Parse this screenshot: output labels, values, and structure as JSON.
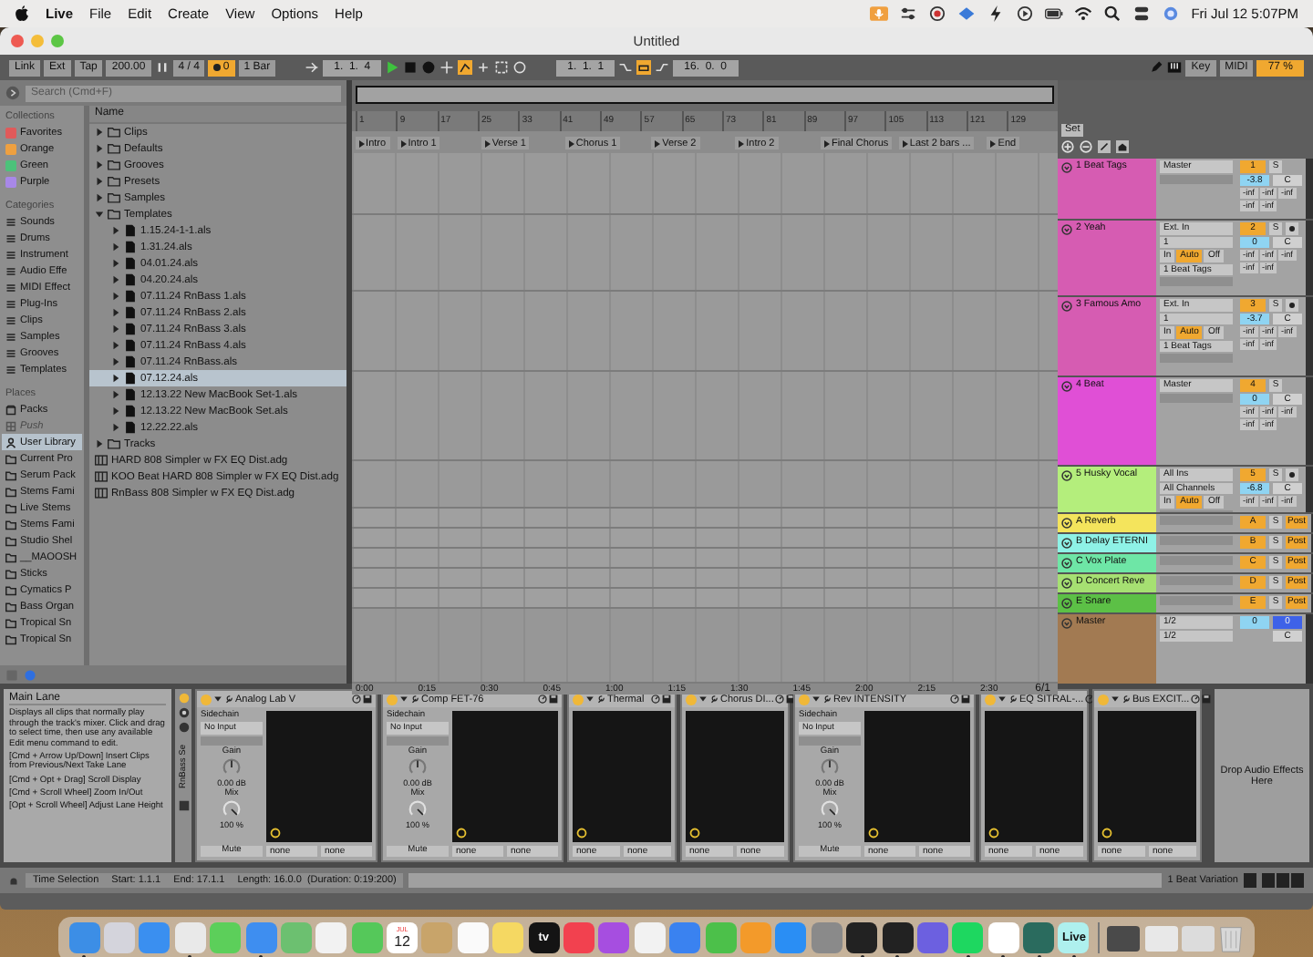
{
  "menu_bar": {
    "app": "Live",
    "items": [
      "File",
      "Edit",
      "Create",
      "View",
      "Options",
      "Help"
    ],
    "clock": "Fri Jul 12  5:07PM"
  },
  "window": {
    "title": "Untitled"
  },
  "transport": {
    "buttons": [
      "Link",
      "Ext",
      "Tap"
    ],
    "tempo": "200.00",
    "signature": "4 / 4",
    "metronome": "0",
    "quantize": "1 Bar",
    "position": "1.  1.  4",
    "playing": true,
    "loop_start": "1.  1.  1",
    "loop_length": "16.  0.  0",
    "key": "Key",
    "midi": "MIDI",
    "cpu": "77 %"
  },
  "browser": {
    "search": {
      "placeholder": "Search (Cmd+F)"
    },
    "sections": [
      {
        "title": "Collections",
        "items": [
          {
            "label": "Favorites",
            "kind": "color",
            "color": "#e05a5a",
            "selected": false
          },
          {
            "label": "Orange",
            "kind": "color",
            "color": "#eea040",
            "selected": false
          },
          {
            "label": "Green",
            "kind": "color",
            "color": "#4cc27a",
            "selected": false
          },
          {
            "label": "Purple",
            "kind": "color",
            "color": "#a888e8",
            "selected": false
          }
        ]
      },
      {
        "title": "Categories",
        "items": [
          {
            "label": "Sounds",
            "kind": "category",
            "selected": false
          },
          {
            "label": "Drums",
            "kind": "category",
            "selected": false
          },
          {
            "label": "Instrument",
            "kind": "category",
            "selected": false
          },
          {
            "label": "Audio Effe",
            "kind": "category",
            "selected": false
          },
          {
            "label": "MIDI Effect",
            "kind": "category",
            "selected": false
          },
          {
            "label": "Plug-Ins",
            "kind": "category",
            "selected": false
          },
          {
            "label": "Clips",
            "kind": "category",
            "selected": false
          },
          {
            "label": "Samples",
            "kind": "category",
            "selected": false
          },
          {
            "label": "Grooves",
            "kind": "category",
            "selected": false
          },
          {
            "label": "Templates",
            "kind": "category",
            "selected": false
          }
        ]
      },
      {
        "title": "Places",
        "items": [
          {
            "label": "Packs",
            "kind": "pack",
            "selected": false,
            "disabled": false
          },
          {
            "label": "Push",
            "kind": "device",
            "selected": false,
            "disabled": true
          },
          {
            "label": "User Library",
            "kind": "user",
            "selected": true,
            "disabled": false
          },
          {
            "label": "Current Pro",
            "kind": "folder",
            "selected": false,
            "disabled": false
          },
          {
            "label": "Serum Pack",
            "kind": "folder",
            "selected": false,
            "disabled": false
          },
          {
            "label": "Stems Fami",
            "kind": "folder",
            "selected": false,
            "disabled": false
          },
          {
            "label": "Live Stems",
            "kind": "folder",
            "selected": false,
            "disabled": false
          },
          {
            "label": "Stems Fami",
            "kind": "folder",
            "selected": false,
            "disabled": false
          },
          {
            "label": "Studio Shel",
            "kind": "folder",
            "selected": false,
            "disabled": false
          },
          {
            "label": "__MAOOSH",
            "kind": "folder",
            "selected": false,
            "disabled": false
          },
          {
            "label": "Sticks",
            "kind": "folder",
            "selected": false,
            "disabled": false
          },
          {
            "label": "Cymatics P",
            "kind": "folder",
            "selected": false,
            "disabled": false
          },
          {
            "label": "Bass Organ",
            "kind": "folder",
            "selected": false,
            "disabled": false
          },
          {
            "label": "Tropical Sn",
            "kind": "folder",
            "selected": false,
            "disabled": false
          },
          {
            "label": "Tropical Sn",
            "kind": "folder",
            "selected": false,
            "disabled": false
          }
        ]
      }
    ],
    "column": "Name",
    "items": [
      {
        "label": "Clips",
        "kind": "folder",
        "expanded": false,
        "selected": false
      },
      {
        "label": "Defaults",
        "kind": "folder",
        "expanded": false,
        "selected": false
      },
      {
        "label": "Grooves",
        "kind": "folder",
        "expanded": false,
        "selected": false
      },
      {
        "label": "Presets",
        "kind": "folder",
        "expanded": false,
        "selected": false
      },
      {
        "label": "Samples",
        "kind": "folder",
        "expanded": false,
        "selected": false
      },
      {
        "label": "Templates",
        "kind": "folder",
        "expanded": true,
        "selected": false,
        "children": [
          {
            "label": "1.15.24-1-1.als",
            "kind": "set",
            "selected": false
          },
          {
            "label": "1.31.24.als",
            "kind": "set",
            "selected": false
          },
          {
            "label": "04.01.24.als",
            "kind": "set",
            "selected": false
          },
          {
            "label": "04.20.24.als",
            "kind": "set",
            "selected": false
          },
          {
            "label": "07.11.24 RnBass 1.als",
            "kind": "set",
            "selected": false
          },
          {
            "label": "07.11.24 RnBass 2.als",
            "kind": "set",
            "selected": false
          },
          {
            "label": "07.11.24 RnBass 3.als",
            "kind": "set",
            "selected": false
          },
          {
            "label": "07.11.24 RnBass 4.als",
            "kind": "set",
            "selected": false
          },
          {
            "label": "07.11.24 RnBass.als",
            "kind": "set",
            "selected": false
          },
          {
            "label": "07.12.24.als",
            "kind": "set",
            "selected": true
          },
          {
            "label": "12.13.22 New MacBook Set-1.als",
            "kind": "set",
            "selected": false
          },
          {
            "label": "12.13.22 New MacBook Set.als",
            "kind": "set",
            "selected": false
          },
          {
            "label": "12.22.22.als",
            "kind": "set",
            "selected": false
          }
        ]
      },
      {
        "label": "Tracks",
        "kind": "folder",
        "expanded": false,
        "selected": false
      },
      {
        "label": "HARD 808 Simpler w FX EQ Dist.adg",
        "kind": "preset",
        "selected": false
      },
      {
        "label": "KOO Beat HARD 808 Simpler w FX EQ Dist.adg",
        "kind": "preset",
        "selected": false
      },
      {
        "label": "RnBass 808 Simpler w FX EQ Dist.adg",
        "kind": "preset",
        "selected": false
      }
    ]
  },
  "arrangement": {
    "bars": [
      "1",
      "9",
      "17",
      "25",
      "33",
      "41",
      "49",
      "57",
      "65",
      "73",
      "81",
      "89",
      "97",
      "105",
      "113",
      "121",
      "129"
    ],
    "locators": [
      "Intro",
      "Intro 1",
      "Verse 1",
      "Chorus 1",
      "Verse 2",
      "Intro 2",
      "Final Chorus",
      "Last 2 bars ...",
      "End"
    ],
    "times": [
      "0:00",
      "0:15",
      "0:30",
      "0:45",
      "1:00",
      "1:15",
      "1:30",
      "1:45",
      "2:00",
      "2:15",
      "2:30"
    ],
    "grid": "6/1",
    "set_button": "Set"
  },
  "tracks": [
    {
      "kind": "track",
      "name": "1 Beat Tags",
      "color": "#d65cb2",
      "routing": [
        "Master"
      ],
      "number": "1",
      "solo": "S",
      "volume": "-3.8",
      "pan": "C",
      "sends": [
        "-inf",
        "-inf",
        "-inf",
        "-inf",
        "-inf"
      ]
    },
    {
      "kind": "track",
      "name": "2 Yeah",
      "color": "#d65cb2",
      "routing": [
        "Ext. In",
        "1"
      ],
      "monitor": [
        {
          "label": "In",
          "selected": false
        },
        {
          "label": "Auto",
          "selected": true
        },
        {
          "label": "Off",
          "selected": false
        }
      ],
      "output": "1 Beat Tags",
      "number": "2",
      "solo": "S",
      "arm": false,
      "volume": "0",
      "pan": "C",
      "sends": [
        "-inf",
        "-inf",
        "-inf",
        "-inf",
        "-inf"
      ]
    },
    {
      "kind": "track",
      "name": "3 Famous Amo",
      "color": "#d65cb2",
      "routing": [
        "Ext. In",
        "1"
      ],
      "monitor": [
        {
          "label": "In",
          "selected": false
        },
        {
          "label": "Auto",
          "selected": true
        },
        {
          "label": "Off",
          "selected": false
        }
      ],
      "output": "1 Beat Tags",
      "number": "3",
      "solo": "S",
      "arm": false,
      "volume": "-3.7",
      "pan": "C",
      "sends": [
        "-inf",
        "-inf",
        "-inf",
        "-inf",
        "-inf"
      ]
    },
    {
      "kind": "track",
      "name": "4 Beat",
      "color": "#e04fd6",
      "routing": [
        "Master"
      ],
      "number": "4",
      "solo": "S",
      "volume": "0",
      "pan": "C",
      "sends": [
        "-inf",
        "-inf",
        "-inf",
        "-inf",
        "-inf"
      ]
    },
    {
      "kind": "track",
      "name": "5 Husky Vocal",
      "color": "#b4ee7c",
      "routing": [
        "All Ins",
        "All Channels"
      ],
      "monitor": [
        {
          "label": "In",
          "selected": false
        },
        {
          "label": "Auto",
          "selected": true
        },
        {
          "label": "Off",
          "selected": false
        }
      ],
      "number": "5",
      "solo": "S",
      "arm": false,
      "volume": "-6.8",
      "pan": "C",
      "sends": [
        "-inf",
        "-inf",
        "-inf"
      ]
    },
    {
      "kind": "return",
      "name": "A Reverb",
      "color": "#f4e45c",
      "number": "A",
      "solo": "S",
      "post": "Post"
    },
    {
      "kind": "return",
      "name": "B Delay ETERNI",
      "color": "#8ef2e6",
      "number": "B",
      "solo": "S",
      "post": "Post"
    },
    {
      "kind": "return",
      "name": "C Vox Plate",
      "color": "#6ee6a6",
      "number": "C",
      "solo": "S",
      "post": "Post"
    },
    {
      "kind": "return",
      "name": "D Concert Reve",
      "color": "#a6e072",
      "number": "D",
      "solo": "S",
      "post": "Post"
    },
    {
      "kind": "return",
      "name": "E Snare",
      "color": "#5cc046",
      "number": "E",
      "solo": "S",
      "post": "Post"
    },
    {
      "kind": "master",
      "name": "Master",
      "color": "#a27a52",
      "routing": [
        "1/2",
        "1/2"
      ],
      "volume": "0",
      "cue": "0",
      "pan": "C"
    }
  ],
  "info": {
    "title": "Main Lane",
    "text": "Displays all clips that normally play through the track's mixer. Click and drag to select time, then use any available Edit menu command to edit.",
    "shortcuts": [
      "[Cmd + Arrow Up/Down] Insert Clips from Previous/Next Take Lane",
      "[Cmd + Opt + Drag] Scroll Display",
      "[Cmd + Scroll Wheel] Zoom In/Out",
      "[Opt + Scroll Wheel] Adjust Lane Height"
    ]
  },
  "chain_label": "RnBass Se",
  "devices": [
    {
      "name": "Analog Lab V",
      "kind": "sidechain",
      "on": true,
      "sidechain": {
        "label": "Sidechain",
        "input": "No Input",
        "gain_label": "Gain",
        "gain": "0.00 dB",
        "mix_label": "Mix",
        "mix": "100 %",
        "mute": "Mute"
      },
      "selects": [
        "none",
        "none"
      ]
    },
    {
      "name": "Comp FET-76",
      "kind": "sidechain",
      "on": true,
      "sidechain": {
        "label": "Sidechain",
        "input": "No Input",
        "gain_label": "Gain",
        "gain": "0.00 dB",
        "mix_label": "Mix",
        "mix": "100 %",
        "mute": "Mute"
      },
      "selects": [
        "none",
        "none"
      ]
    },
    {
      "name": "Thermal",
      "kind": "plain",
      "on": true,
      "selects": [
        "none",
        "none"
      ]
    },
    {
      "name": "Chorus DI...",
      "kind": "plain",
      "on": true,
      "selects": [
        "none",
        "none"
      ]
    },
    {
      "name": "Rev INTENSITY",
      "kind": "sidechain",
      "on": true,
      "sidechain": {
        "label": "Sidechain",
        "input": "No Input",
        "gain_label": "Gain",
        "gain": "0.00 dB",
        "mix_label": "Mix",
        "mix": "100 %",
        "mute": "Mute"
      },
      "selects": [
        "none",
        "none"
      ]
    },
    {
      "name": "EQ SITRAL-...",
      "kind": "plain",
      "on": true,
      "selects": [
        "none",
        "none"
      ]
    },
    {
      "name": "Bus EXCIT...",
      "kind": "plain",
      "on": true,
      "selects": [
        "none",
        "none"
      ]
    }
  ],
  "drop_zone": "Drop Audio Effects Here",
  "status_bar": {
    "items": [
      "Time Selection",
      "Start: 1.1.1",
      "End: 17.1.1",
      "Length: 16.0.0  (Duration: 0:19:200)"
    ],
    "right": "1 Beat Variation"
  },
  "dock": [
    {
      "kind": "app",
      "color": "#3c8ee6",
      "running": true
    },
    {
      "kind": "app",
      "color": "#d4d4dc"
    },
    {
      "kind": "app",
      "color": "#3a8ff0"
    },
    {
      "kind": "app",
      "color": "#e9e9e9",
      "running": true
    },
    {
      "kind": "app",
      "color": "#5ccf5a"
    },
    {
      "kind": "app",
      "color": "#3e8ef0",
      "running": true
    },
    {
      "kind": "app",
      "color": "#6cc070"
    },
    {
      "kind": "app",
      "color": "#f2f2f2"
    },
    {
      "kind": "app",
      "color": "#55c85a"
    },
    {
      "kind": "calendar",
      "color": "#ffffff",
      "month": "JUL",
      "day": "12"
    },
    {
      "kind": "app",
      "color": "#c8a46a"
    },
    {
      "kind": "app",
      "color": "#fafafa"
    },
    {
      "kind": "app",
      "color": "#f5d862"
    },
    {
      "kind": "label",
      "color": "#141414",
      "label": "tv"
    },
    {
      "kind": "app",
      "color": "#f2414f"
    },
    {
      "kind": "app",
      "color": "#a64ee0"
    },
    {
      "kind": "app",
      "color": "#f2f2f2"
    },
    {
      "kind": "app",
      "color": "#3a82f0"
    },
    {
      "kind": "app",
      "color": "#4cc04a"
    },
    {
      "kind": "app",
      "color": "#f39a2a"
    },
    {
      "kind": "app",
      "color": "#2a8ef4"
    },
    {
      "kind": "app",
      "color": "#8a8a8a"
    },
    {
      "kind": "app",
      "color": "#222222",
      "running": true
    },
    {
      "kind": "app",
      "color": "#222222",
      "running": true
    },
    {
      "kind": "app",
      "color": "#6c60e0"
    },
    {
      "kind": "app",
      "color": "#1ed760",
      "running": true
    },
    {
      "kind": "app",
      "color": "#ffffff",
      "running": true
    },
    {
      "kind": "app",
      "color": "#2a6b5e",
      "running": true
    },
    {
      "kind": "label",
      "color": "#aef0ee",
      "label": "Live",
      "running": true
    },
    {
      "kind": "window",
      "color": "#4a4a4a"
    },
    {
      "kind": "window",
      "color": "#e8e8e8"
    },
    {
      "kind": "window",
      "color": "#dcdcdc"
    },
    {
      "kind": "trash",
      "color": "#d8d8d8"
    }
  ]
}
